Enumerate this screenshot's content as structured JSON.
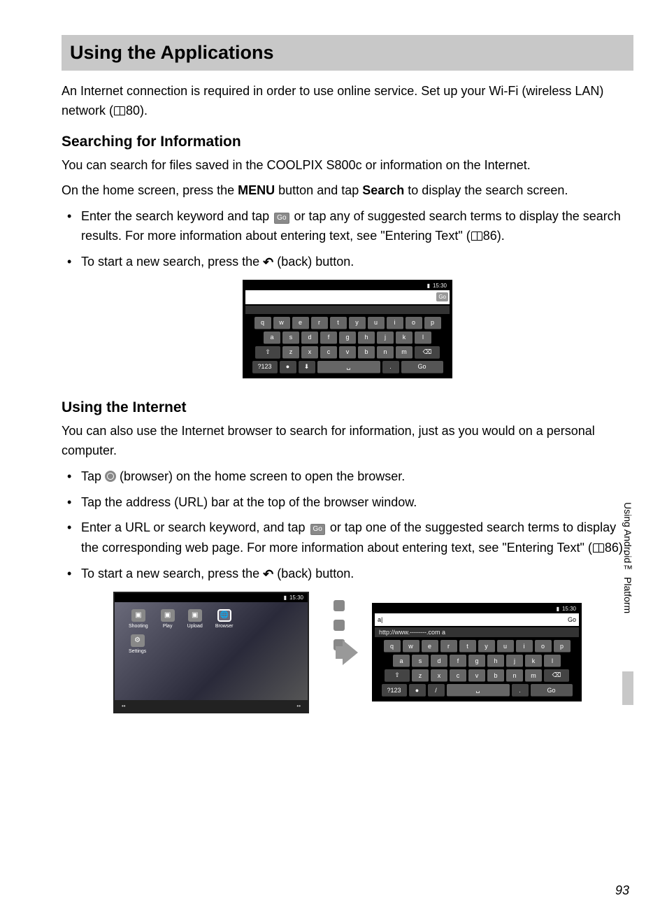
{
  "title": "Using the Applications",
  "intro": "An Internet connection is required in order to use online service. Set up your Wi-Fi (wireless LAN) network (",
  "intro_ref": "80).",
  "section1": {
    "heading": "Searching for Information",
    "p1": "You can search for files saved in the COOLPIX S800c or information on the Internet.",
    "p2_pre": "On the home screen, press the ",
    "p2_menu": "MENU",
    "p2_mid": " button and tap ",
    "p2_search": "Search",
    "p2_post": " to display the search screen.",
    "b1_pre": "Enter the search keyword and tap ",
    "b1_go": "Go",
    "b1_mid": " or tap any of suggested search terms to display the search results. For more information about entering text, see \"Entering Text\" (",
    "b1_ref": "86).",
    "b2_pre": "To start a new search, press the ",
    "b2_post": " (back) button."
  },
  "section2": {
    "heading": "Using the Internet",
    "p1": "You can also use the Internet browser to search for information, just as you would on a personal computer.",
    "b1_pre": "Tap ",
    "b1_post": " (browser) on the home screen to open the browser.",
    "b2": "Tap the address (URL) bar at the top of the browser window.",
    "b3_pre": "Enter a URL or search keyword, and tap ",
    "b3_go": "Go",
    "b3_mid": " or tap one of the suggested search terms to display the corresponding web page. For more information about entering text, see \"Entering Text\" (",
    "b3_ref": "86).",
    "b4_pre": "To start a new search, press the ",
    "b4_post": " (back) button."
  },
  "fig1": {
    "time": "15:30",
    "go": "Go",
    "row1": [
      "q",
      "w",
      "e",
      "r",
      "t",
      "y",
      "u",
      "i",
      "o",
      "p"
    ],
    "row2": [
      "a",
      "s",
      "d",
      "f",
      "g",
      "h",
      "j",
      "k",
      "l"
    ],
    "row3": [
      "⇧",
      "z",
      "x",
      "c",
      "v",
      "b",
      "n",
      "m",
      "⌫"
    ],
    "row4": {
      "sym": "?123",
      "mic": "●",
      "voice": "⬇",
      "space": "␣",
      "dot": ".",
      "go": "Go"
    }
  },
  "fig2": {
    "home": {
      "time": "15:30",
      "icons": [
        {
          "label": "Shooting"
        },
        {
          "label": "Play"
        },
        {
          "label": "Upload"
        },
        {
          "label": "Browser"
        }
      ],
      "settings": "Settings"
    },
    "browser": {
      "time": "15:30",
      "go": "Go",
      "addr": "a|",
      "sugg": "http://www.--------.com  a",
      "row1": [
        "q",
        "w",
        "e",
        "r",
        "t",
        "y",
        "u",
        "i",
        "o",
        "p"
      ],
      "row2": [
        "a",
        "s",
        "d",
        "f",
        "g",
        "h",
        "j",
        "k",
        "l"
      ],
      "row3": [
        "⇧",
        "z",
        "x",
        "c",
        "v",
        "b",
        "n",
        "m",
        "⌫"
      ],
      "row4": {
        "sym": "?123",
        "mic": "●",
        "slash": "/",
        "space": "␣",
        "dot": ".",
        "go": "Go"
      }
    }
  },
  "sideTab": "Using Android™ Platform",
  "pageNum": "93"
}
